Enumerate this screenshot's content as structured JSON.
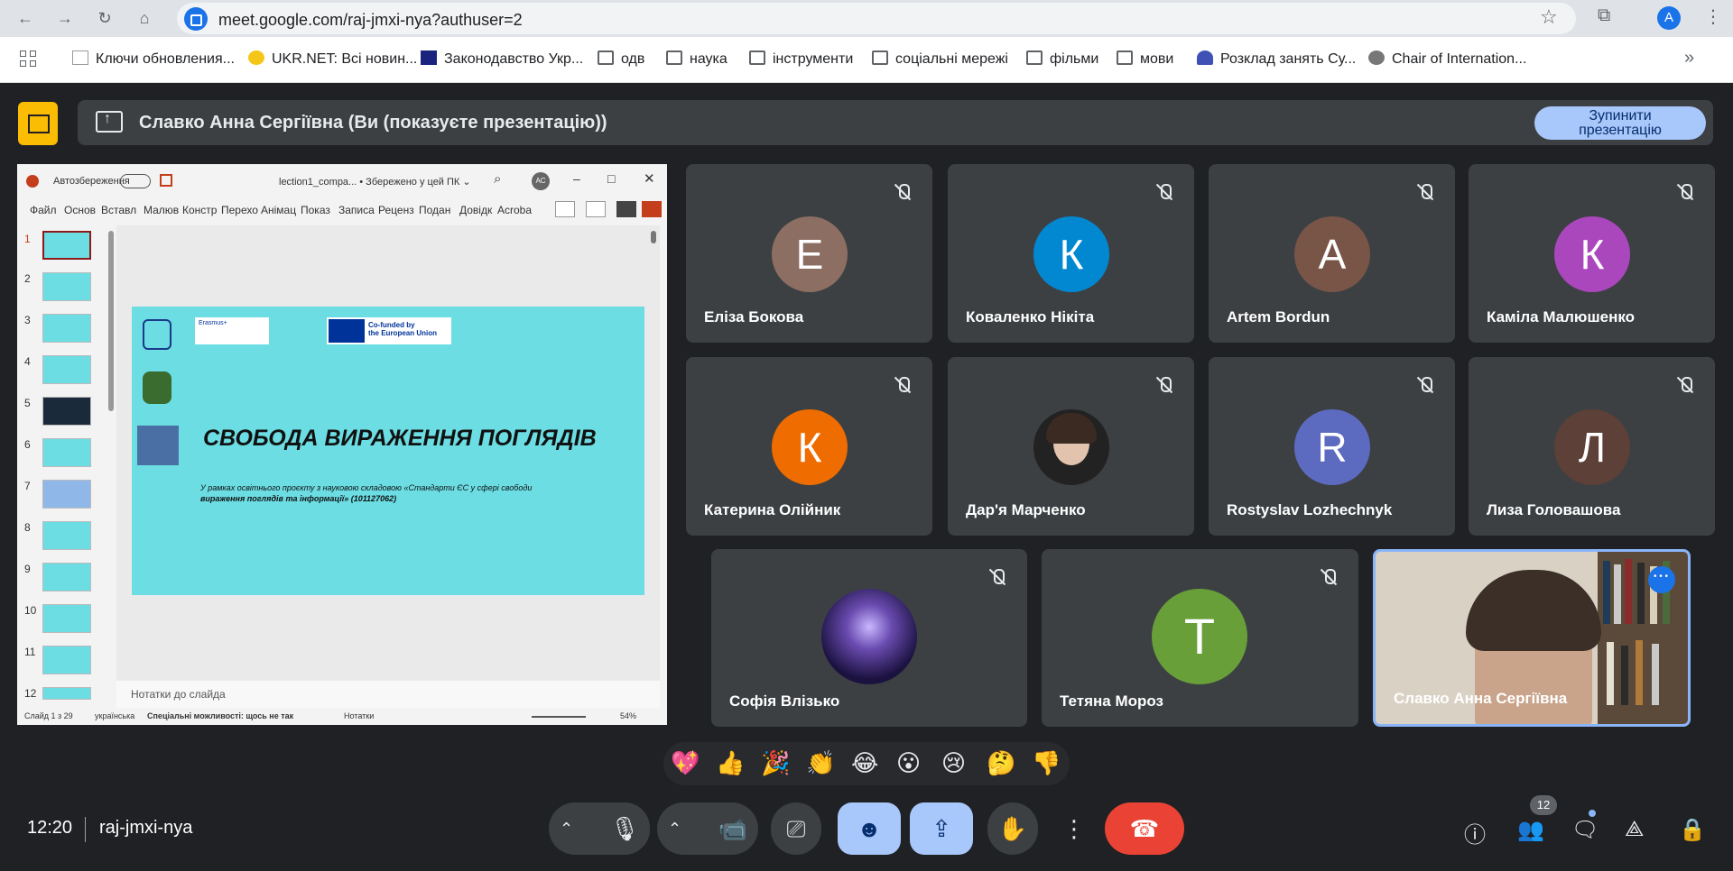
{
  "browser": {
    "url": "meet.google.com/raj-jmxi-nya?authuser=2",
    "profile_initial": "A",
    "bookmarks": [
      "Ключи обновления...",
      "UKR.NET: Всі новин...",
      "Законодавство Укр...",
      "одв",
      "наука",
      "інструменти",
      "соціальні мережі",
      "фільми",
      "мови",
      "Розклад занять Су...",
      "Chair of Internation..."
    ]
  },
  "banner": {
    "text": "Славко Анна Сергіївна (Ви (показуєте презентацію))",
    "stop_line1": "Зупинити",
    "stop_line2": "презентацію"
  },
  "ppt": {
    "autosave": "Автозбереження",
    "filename": "lection1_compa...  •  Збережено у цей ПК ⌄",
    "user_initials": "AC",
    "ribbon": [
      "Файл",
      "Основ",
      "Вставл",
      "Малюв",
      "Констр",
      "Перехо",
      "Анімац",
      "Показ",
      "Записа",
      "Реценз",
      "Подан",
      "Довідк",
      "Acroba"
    ],
    "slide_numbers": [
      "1",
      "2",
      "3",
      "4",
      "5",
      "6",
      "7",
      "8",
      "9",
      "10",
      "11",
      "12"
    ],
    "slide_title": "СВОБОДА ВИРАЖЕННЯ ПОГЛЯДІВ",
    "slide_subtitle_a": "У рамках освітнього проєкту з науковою складовою «Стандарти ЄС у сфері свободи",
    "slide_subtitle_b": "вираження поглядів та інформації» (101127062)",
    "eu_text_a": "Co-funded by",
    "eu_text_b": "the European Union",
    "erasmus": "Erasmus+",
    "notes": "Нотатки до слайда",
    "status_slide": "Слайд 1 з 29",
    "status_lang": "українська",
    "status_access": "Спеціальні можливості: щось не так",
    "status_notes": "Нотатки",
    "zoom": "54%"
  },
  "participants": [
    {
      "name": "Еліза Бокова",
      "initial": "Е",
      "color": "#8d6e63"
    },
    {
      "name": "Коваленко Нікіта",
      "initial": "К",
      "color": "#0288d1"
    },
    {
      "name": "Artem Bordun",
      "initial": "A",
      "color": "#795548"
    },
    {
      "name": "Каміла Малюшенко",
      "initial": "К",
      "color": "#ab47bc"
    },
    {
      "name": "Катерина Олійник",
      "initial": "К",
      "color": "#ef6c00"
    },
    {
      "name": "Дар'я Марченко",
      "initial": "",
      "color": "#222222"
    },
    {
      "name": "Rostyslav Lozhechnyk",
      "initial": "R",
      "color": "#5c6bc0"
    },
    {
      "name": "Лиза Головашова",
      "initial": "Л",
      "color": "#5d4037"
    },
    {
      "name": "Софія Влізько",
      "initial": "",
      "color": "#3b2a6b"
    },
    {
      "name": "Тетяна Мороз",
      "initial": "T",
      "color": "#689f38"
    },
    {
      "name": "Славко Анна Сергіївна",
      "initial": "",
      "color": "#d9d2c4"
    }
  ],
  "reactions": [
    "💖",
    "👍",
    "🎉",
    "👏",
    "😂",
    "😮",
    "😢",
    "🤔",
    "👎"
  ],
  "footer": {
    "time": "12:20",
    "meeting_code": "raj-jmxi-nya",
    "people_count": "12"
  },
  "icons": {
    "mic": "mic-icon",
    "camera": "camera-icon",
    "captions": "captions-icon",
    "emoji": "emoji-icon",
    "present": "present-icon",
    "hand": "raise-hand-icon",
    "more": "more-options-icon",
    "hangup": "hang-up-icon"
  }
}
